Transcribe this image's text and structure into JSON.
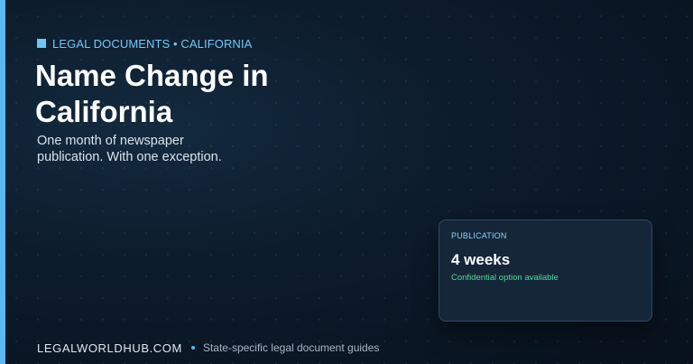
{
  "header": {
    "eyebrow": "LEGAL DOCUMENTS • CALIFORNIA",
    "title_lines": [
      "Name Change in",
      "California"
    ],
    "subtitle_lines": [
      "One month of newspaper",
      "publication. With one exception."
    ]
  },
  "card": {
    "label": "PUBLICATION",
    "value": "4 weeks",
    "note": "Confidential option available"
  },
  "footer": {
    "brand": "LEGALWORLDHUB.COM",
    "tagline": "State-specific legal document guides"
  },
  "colors": {
    "accent": "#5cb8ee",
    "background": "#0d1c2c",
    "card_background": "#152639",
    "note_green": "#52d89a"
  }
}
